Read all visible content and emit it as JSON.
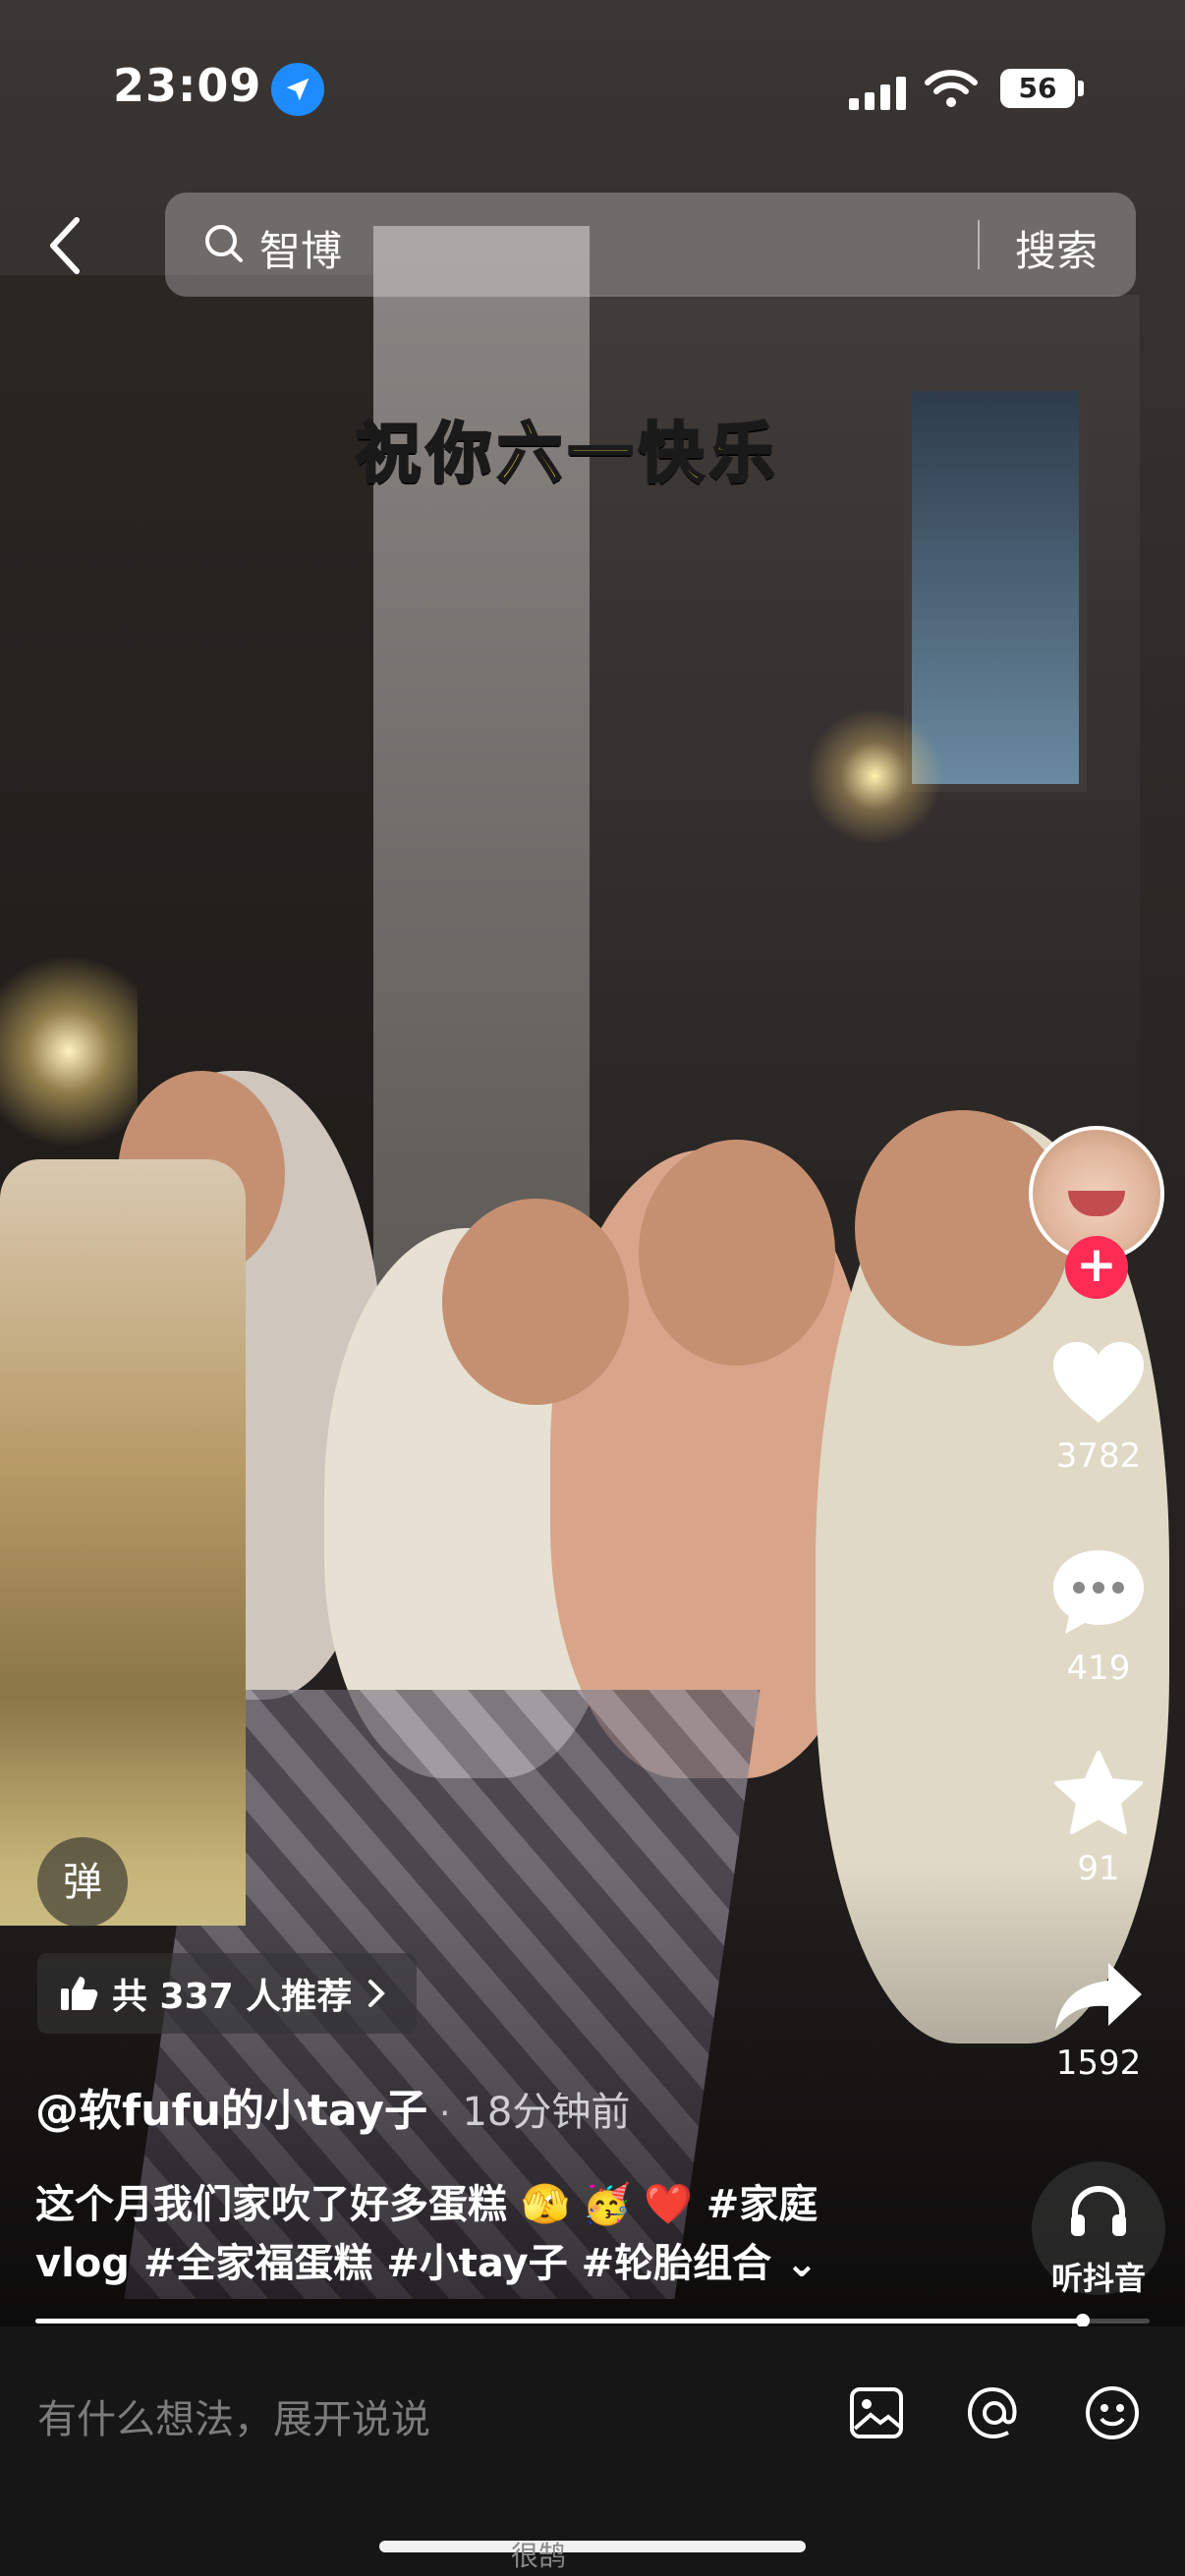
{
  "status_bar": {
    "time": "23:09",
    "battery": "56"
  },
  "search": {
    "query": "智博",
    "button": "搜索"
  },
  "video": {
    "caption": "祝你六一快乐"
  },
  "actions": {
    "likes": "3782",
    "comments": "419",
    "favorites": "91",
    "shares": "1592",
    "listen_label": "听抖音",
    "follow_symbol": "+"
  },
  "overlay": {
    "danmaku_label": "弹",
    "recommend_label": "共 337 人推荐",
    "author": "@软fufu的小tay子",
    "separator": "·",
    "posted_time": "18分钟前",
    "description": {
      "text_before": "这个月我们家吹了好多蛋糕 ",
      "emojis": "🫣 🥳 ❤️",
      "tags_line1": " #家庭",
      "tags_line2": "vlog #全家福蛋糕 #小tay子 #轮胎组合",
      "expand": "⌄"
    },
    "progress": 0.94
  },
  "comment_bar": {
    "placeholder": "有什么想法，展开说说",
    "watermark": "很鹄"
  },
  "colors": {
    "accent": "#fe2c55",
    "caption": "#ffe23a",
    "location": "#1e8cff"
  }
}
